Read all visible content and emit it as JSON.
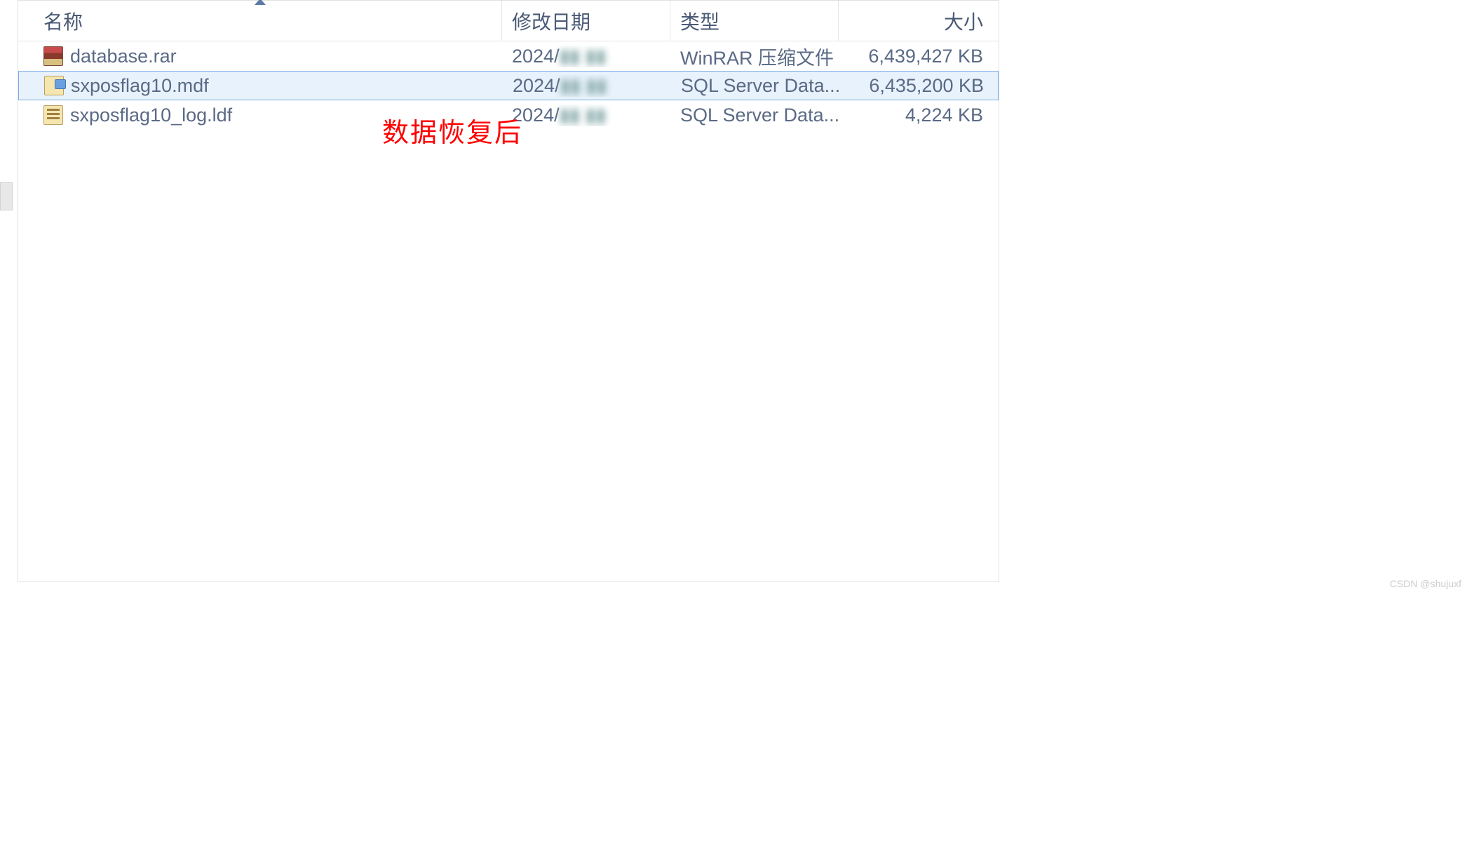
{
  "columns": {
    "name": "名称",
    "date": "修改日期",
    "type": "类型",
    "size": "大小"
  },
  "files": [
    {
      "icon": "rar",
      "name": "database.rar",
      "date_prefix": "2024/",
      "date_blurred": "▮▮ ▮▮",
      "type": "WinRAR 压缩文件",
      "size": "6,439,427 KB",
      "selected": false
    },
    {
      "icon": "mdf",
      "name": "sxposflag10.mdf",
      "date_prefix": "2024/",
      "date_blurred": "▮▮ ▮▮",
      "type": "SQL Server Data...",
      "size": "6,435,200 KB",
      "selected": true
    },
    {
      "icon": "ldf",
      "name": "sxposflag10_log.ldf",
      "date_prefix": "2024/",
      "date_blurred": "▮▮ ▮▮",
      "type": "SQL Server Data...",
      "size": "4,224 KB",
      "selected": false
    }
  ],
  "annotation": "数据恢复后",
  "watermark": "CSDN @shujuxf"
}
